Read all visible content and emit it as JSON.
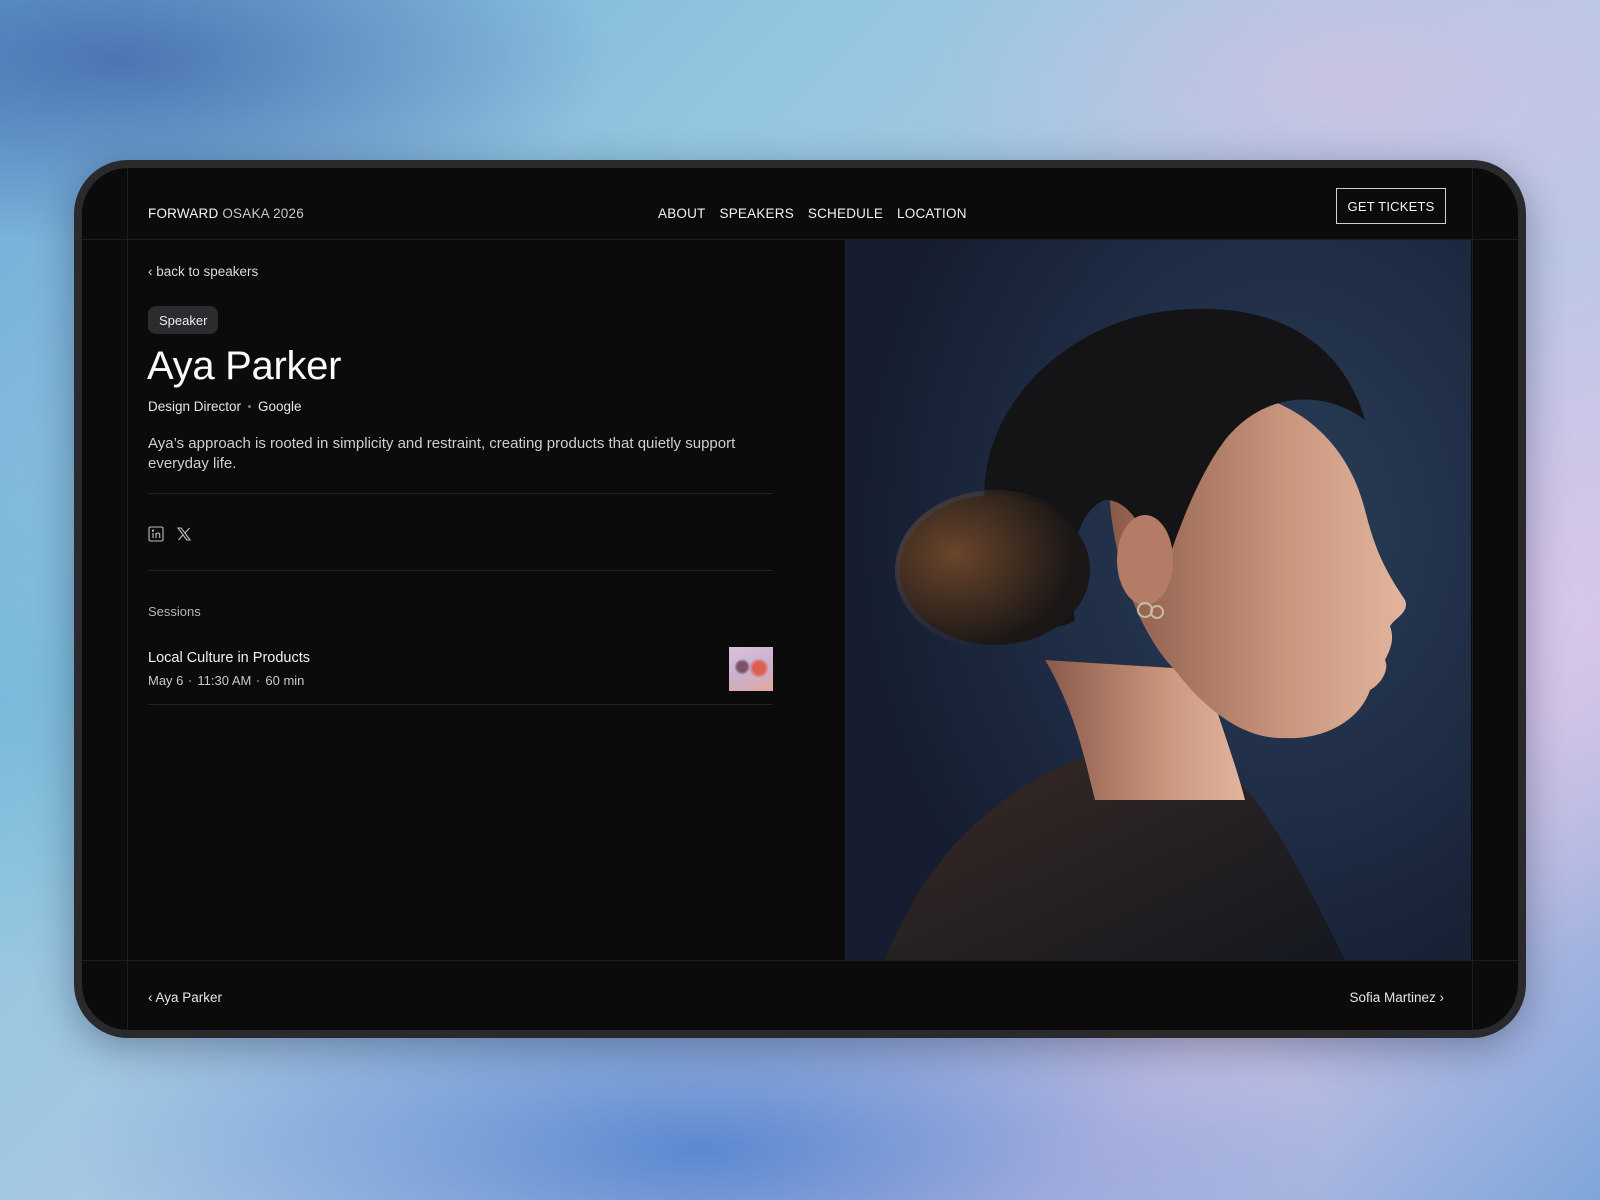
{
  "header": {
    "brand_strong": "FORWARD",
    "brand_light": "OSAKA 2026",
    "nav": [
      "ABOUT",
      "SPEAKERS",
      "SCHEDULE",
      "LOCATION"
    ],
    "cta_label": "GET TICKETS"
  },
  "speaker": {
    "back_label": "‹ back to speakers",
    "badge": "Speaker",
    "name": "Aya Parker",
    "title": "Design Director",
    "company": "Google",
    "bio": "Aya’s approach is rooted in simplicity and restraint, creating products that quietly support everyday life.",
    "socials": [
      "linkedin-icon",
      "x-icon"
    ]
  },
  "sessions": {
    "label": "Sessions",
    "items": [
      {
        "title": "Local Culture in Products",
        "date": "May 6",
        "time": "11:30 AM",
        "duration": "60 min"
      }
    ]
  },
  "footer": {
    "prev_label": "‹ Aya Parker",
    "next_label": "Sofia Martinez ›"
  },
  "colors": {
    "screen_bg": "#0b0b0c",
    "text": "#f2f2f2",
    "muted": "#c9c9c9",
    "badge_bg": "#2c2c2e"
  }
}
